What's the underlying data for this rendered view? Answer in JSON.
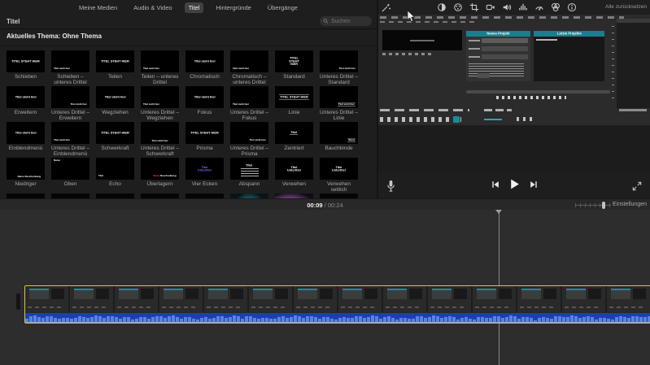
{
  "browser": {
    "tabs": [
      {
        "label": "Meine Medien",
        "active": false
      },
      {
        "label": "Audio & Video",
        "active": false
      },
      {
        "label": "Titel",
        "active": true
      },
      {
        "label": "Hintergründe",
        "active": false
      },
      {
        "label": "Übergänge",
        "active": false
      }
    ],
    "pane_title": "Titel",
    "search": {
      "placeholder": "Suchen",
      "icon": "search-icon"
    },
    "theme_heading": "Aktuelles Thema: Ohne Thema",
    "tiles": [
      {
        "name": "Schieben",
        "sample": "TITEL STEHT HIER",
        "style": "center"
      },
      {
        "name": "Schieben – unteres Drittel",
        "sample": "Titel steht hier",
        "style": "lower-left"
      },
      {
        "name": "Teilen",
        "sample": "TITEL STEHT HIER",
        "style": "center"
      },
      {
        "name": "Teilen – unteres Drittel",
        "sample": "Titel steht hier",
        "style": "lower-left"
      },
      {
        "name": "Chromatisch",
        "sample": "Titel steht hier",
        "style": "center"
      },
      {
        "name": "Chromatisch – unteres Drittel",
        "sample": "Titel steht hier",
        "style": "lower-left"
      },
      {
        "name": "Standard",
        "sample": "TITEL STEHT HIER",
        "style": "center-stack"
      },
      {
        "name": "Unteres Drittel – Standard",
        "sample": "Titel steht hier",
        "style": "lower-right"
      },
      {
        "name": "Erweitern",
        "sample": "Titel steht hier",
        "style": "center"
      },
      {
        "name": "Unteres Drittel – Erweitern",
        "sample": "Titel steht hier",
        "style": "lower-right"
      },
      {
        "name": "Wegziehen",
        "sample": "Titel steht hier",
        "style": "center"
      },
      {
        "name": "Unteres Drittel – Wegziehen",
        "sample": "Titel steht hier",
        "style": "lower-left"
      },
      {
        "name": "Fokus",
        "sample": "Titel steht hier",
        "style": "center"
      },
      {
        "name": "Unteres Drittel – Fokus",
        "sample": "Titel steht hier",
        "style": "lower-left"
      },
      {
        "name": "Linie",
        "sample": "TITEL STEHT HIER",
        "style": "center-lines"
      },
      {
        "name": "Unteres Drittel – Linie",
        "sample": "Titel steht hier",
        "style": "lower-right-lines"
      },
      {
        "name": "Einblendmenü",
        "sample": "Titel steht hier",
        "style": "center"
      },
      {
        "name": "Unteres Drittel – Einblendmenü",
        "sample": "Titel steht hier",
        "style": "lower-left"
      },
      {
        "name": "Schwerkraft",
        "sample": "TITEL STEHT HIER",
        "style": "center"
      },
      {
        "name": "Unteres Drittel – Schwerkraft",
        "sample": "Titel steht hier",
        "style": "lower-center"
      },
      {
        "name": "Prisma",
        "sample": "TITEL STEHT HIER",
        "style": "center"
      },
      {
        "name": "Unteres Drittel – Prisma",
        "sample": "Titel steht hier",
        "style": "lower-right"
      },
      {
        "name": "Zentriert",
        "sample": "Titel",
        "style": "center-underline"
      },
      {
        "name": "Bauchbinde",
        "sample": "Name",
        "style": "lower-right-lines"
      },
      {
        "name": "Niedriger",
        "sample": "Name Beschreibung",
        "style": "lower-center"
      },
      {
        "name": "Oben",
        "sample": "Name",
        "style": "top-left"
      },
      {
        "name": "Echo",
        "sample": "Titel",
        "style": "lower-left"
      },
      {
        "name": "Überlagern",
        "sample": "Name Beschreibung",
        "style": "two-tone"
      },
      {
        "name": "Vier Ecken",
        "sample": "Titel Untertitel",
        "style": "center-blue"
      },
      {
        "name": "Abspann",
        "sample": "Titel",
        "style": "credits"
      },
      {
        "name": "Verwehen",
        "sample": "Titel Untertitel",
        "style": "center-stack"
      },
      {
        "name": "Verwehen seitlich",
        "sample": "Titel Untertitel",
        "style": "center-stack"
      }
    ],
    "partial_row_styles": [
      "plain",
      "plain",
      "plain",
      "plain",
      "plain",
      "teal",
      "purple",
      "plain"
    ]
  },
  "preview": {
    "reset_label": "Alle zurücksetzen",
    "enhance_icon": "magic-wand-icon",
    "adjust_icons": [
      "color-balance",
      "color-correction",
      "crop",
      "stabilization",
      "volume",
      "noise-reduction",
      "speed",
      "effects",
      "info"
    ],
    "video_frame": {
      "dialog_new_project_title": "Neues Projekt",
      "dialog_recent_projects_title": "Letzte Projekte",
      "accent_teal": "#1d7d8f"
    },
    "playback_icons": [
      "microphone",
      "previous-frame",
      "play",
      "next-frame",
      "fullscreen"
    ]
  },
  "scrub_bar": {
    "current_time": "00:09",
    "separator": "/",
    "total_time": "00:24",
    "settings_label": "Einstellungen"
  },
  "timeline": {
    "clip": {
      "selected": true,
      "selection_color": "#e0c23a",
      "waveform_bg": "#1d3fae",
      "waveform_color": "#5b83da"
    }
  }
}
